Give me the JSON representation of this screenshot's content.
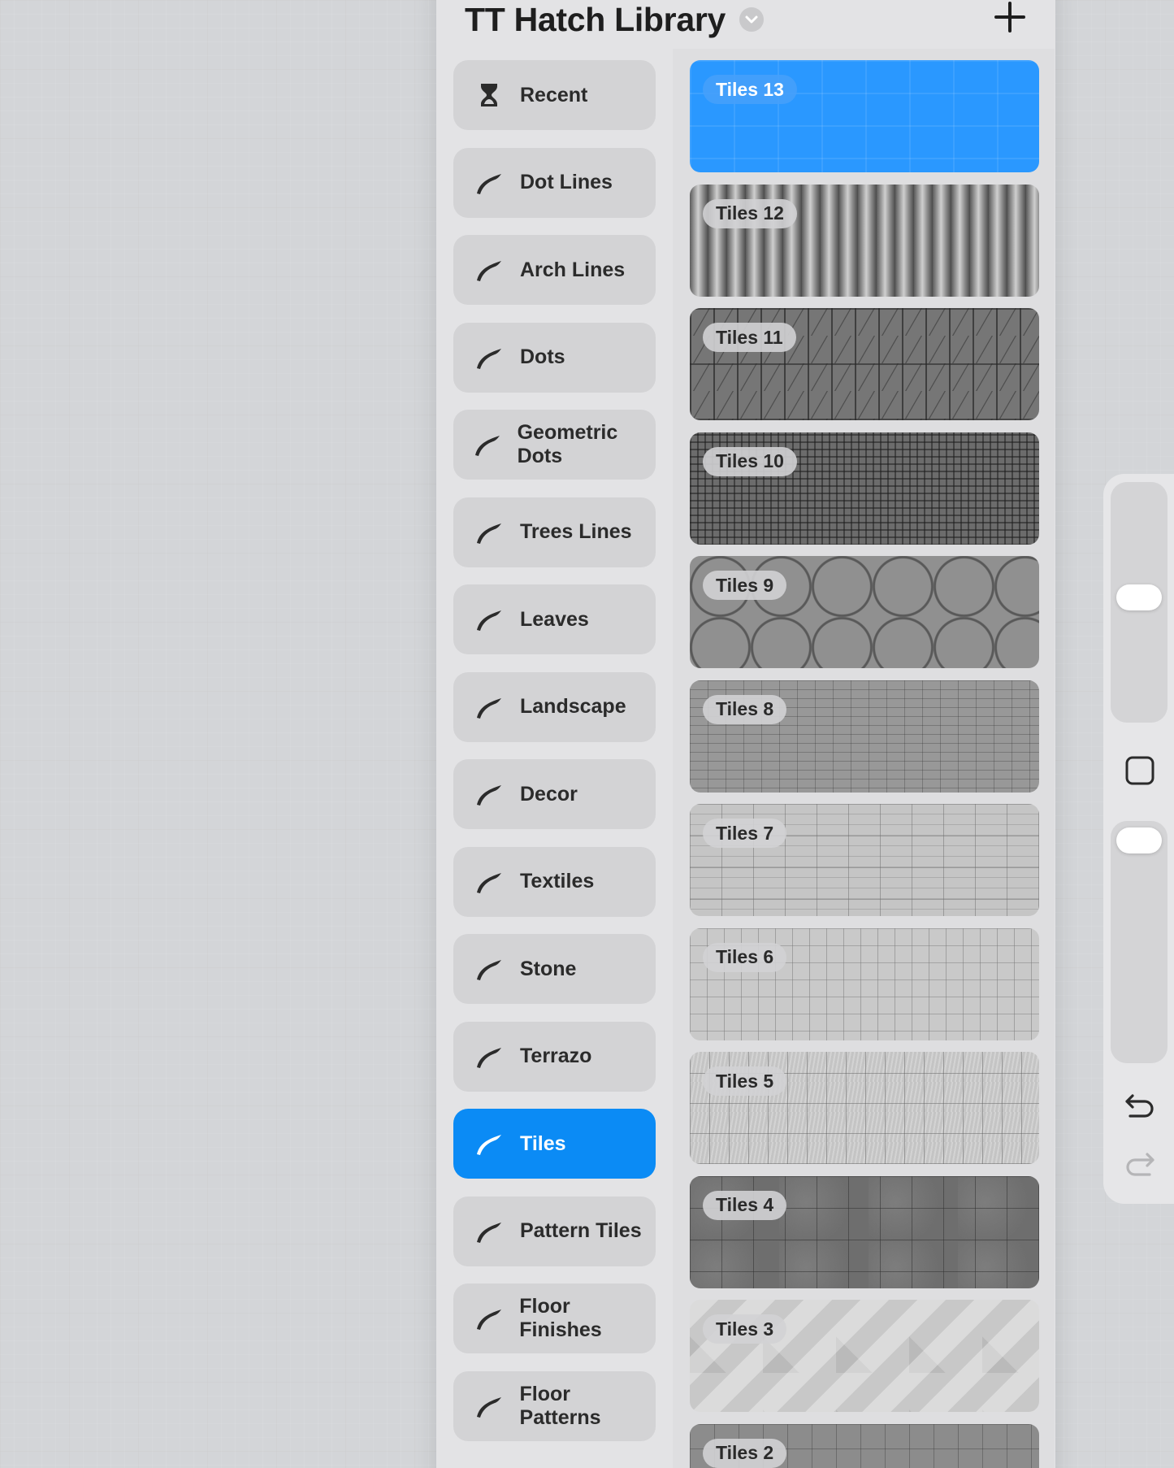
{
  "library": {
    "title": "TT Hatch Library",
    "title_icon": "chevron-down-icon",
    "add_icon": "plus-icon"
  },
  "brush_sets": [
    {
      "label": "Recent",
      "icon": "hourglass-icon",
      "active": false
    },
    {
      "label": "Dot Lines",
      "icon": "brush-stroke-icon",
      "active": false
    },
    {
      "label": "Arch Lines",
      "icon": "brush-stroke-icon",
      "active": false
    },
    {
      "label": "Dots",
      "icon": "brush-stroke-icon",
      "active": false
    },
    {
      "label": "Geometric Dots",
      "icon": "brush-stroke-icon",
      "active": false
    },
    {
      "label": "Trees Lines",
      "icon": "brush-stroke-icon",
      "active": false
    },
    {
      "label": "Leaves",
      "icon": "brush-stroke-icon",
      "active": false
    },
    {
      "label": "Landscape",
      "icon": "brush-stroke-icon",
      "active": false
    },
    {
      "label": "Decor",
      "icon": "brush-stroke-icon",
      "active": false
    },
    {
      "label": "Textiles",
      "icon": "brush-stroke-icon",
      "active": false
    },
    {
      "label": "Stone",
      "icon": "brush-stroke-icon",
      "active": false
    },
    {
      "label": "Terrazo",
      "icon": "brush-stroke-icon",
      "active": false
    },
    {
      "label": "Tiles",
      "icon": "brush-stroke-icon",
      "active": true
    },
    {
      "label": "Pattern Tiles",
      "icon": "brush-stroke-icon",
      "active": false
    },
    {
      "label": "Floor Finishes",
      "icon": "brush-stroke-icon",
      "active": false
    },
    {
      "label": "Floor Patterns",
      "icon": "brush-stroke-icon",
      "active": false
    }
  ],
  "brushes": [
    {
      "label": "Tiles 13",
      "selected": true
    },
    {
      "label": "Tiles 12",
      "selected": false
    },
    {
      "label": "Tiles 11",
      "selected": false
    },
    {
      "label": "Tiles 10",
      "selected": false
    },
    {
      "label": "Tiles 9",
      "selected": false
    },
    {
      "label": "Tiles 8",
      "selected": false
    },
    {
      "label": "Tiles 7",
      "selected": false
    },
    {
      "label": "Tiles 6",
      "selected": false
    },
    {
      "label": "Tiles 5",
      "selected": false
    },
    {
      "label": "Tiles 4",
      "selected": false
    },
    {
      "label": "Tiles 3",
      "selected": false
    },
    {
      "label": "Tiles 2",
      "selected": false
    }
  ],
  "sidebar": {
    "brush_size_icon": "slider-thumb",
    "modify_icon": "square-icon",
    "opacity_icon": "slider-thumb",
    "undo_icon": "undo-arrow-icon",
    "redo_icon": "redo-arrow-icon"
  },
  "colors": {
    "accent": "#0b8bf5",
    "selected_brush": "#2a98ff",
    "panel": "#e3e3e5",
    "set_button": "#d3d3d5",
    "canvas": "#d3d5d8"
  }
}
